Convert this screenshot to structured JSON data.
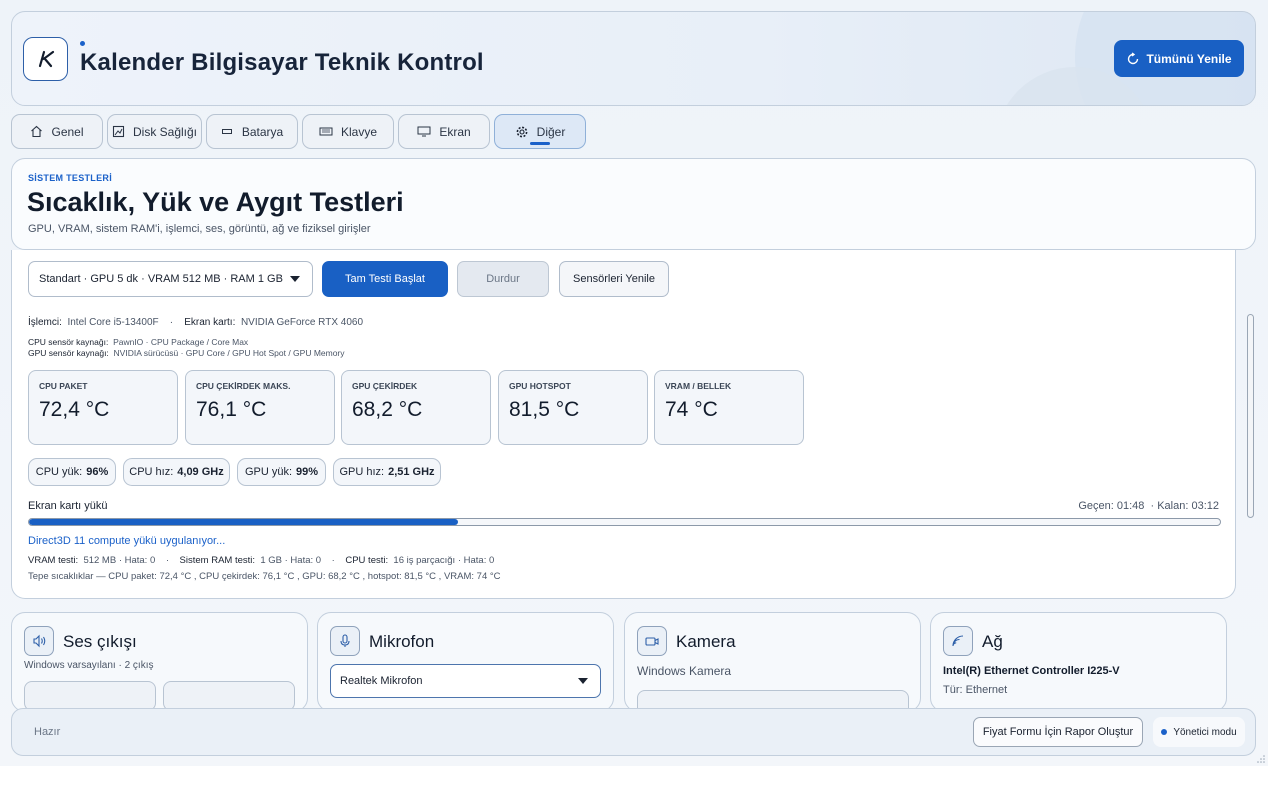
{
  "app": {
    "title": "Kalender Bilgisayar Teknik Kontrol",
    "refresh_all_label": "Tümünü Yenile",
    "accent": "#1960c4"
  },
  "tabs": [
    {
      "label": "Genel",
      "icon": "home-icon"
    },
    {
      "label": "Disk Sağlığı",
      "icon": "disk-icon"
    },
    {
      "label": "Batarya",
      "icon": "battery-icon"
    },
    {
      "label": "Klavye",
      "icon": "keyboard-icon"
    },
    {
      "label": "Ekran",
      "icon": "monitor-icon"
    },
    {
      "label": "Diğer",
      "icon": "gear-icon",
      "active": true
    }
  ],
  "section": {
    "eyebrow": "SİSTEM TESTLERİ",
    "title": "Sıcaklık, Yük ve Aygıt Testleri",
    "subtitle": "GPU, VRAM, sistem RAM'i, işlemci, ses, görüntü, ağ ve fiziksel girişler"
  },
  "controls": {
    "profile_selected": "Standart · GPU 5 dk · VRAM 512 MB · RAM 1 GB",
    "start_label": "Tam Testi Başlat",
    "stop_label": "Durdur",
    "sensors_label": "Sensörleri Yenile"
  },
  "hardware": {
    "cpu_key": "İşlemci:",
    "cpu_value": "Intel Core i5-13400F",
    "separator": "·",
    "gpu_key": "Ekran kartı:",
    "gpu_value": "NVIDIA GeForce RTX 4060",
    "cpu_source_key": "CPU sensör kaynağı:",
    "cpu_source_value": "PawnIO · CPU Package / Core Max",
    "gpu_source_key": "GPU sensör kaynağı:",
    "gpu_source_value": "NVIDIA sürücüsü · GPU Core / GPU Hot Spot / GPU Memory"
  },
  "temps": [
    {
      "label": "CPU PAKET",
      "value": "72,4 °C"
    },
    {
      "label": "CPU ÇEKİRDEK MAKS.",
      "value": "76,1 °C"
    },
    {
      "label": "GPU ÇEKİRDEK",
      "value": "68,2 °C"
    },
    {
      "label": "GPU HOTSPOT",
      "value": "81,5 °C"
    },
    {
      "label": "VRAM / BELLEK",
      "value": "74 °C"
    }
  ],
  "loads": [
    {
      "key": "CPU yük:",
      "value": "96%"
    },
    {
      "key": "CPU hız:",
      "value": "4,09 GHz"
    },
    {
      "key": "GPU yük:",
      "value": "99%"
    },
    {
      "key": "GPU hız:",
      "value": "2,51 GHz"
    }
  ],
  "progress": {
    "label": "Ekran kartı yükü",
    "elapsed": "Geçen: 01:48",
    "remaining": "· Kalan: 03:12",
    "fraction": 0.36,
    "status": "Direct3D 11 compute yükü uygulanıyor..."
  },
  "stats": {
    "vram_key": "VRAM testi:",
    "vram_value": "512 MB · Hata: 0",
    "ram_key": "Sistem RAM testi:",
    "ram_value": "1 GB · Hata: 0",
    "cpu_key": "CPU testi:",
    "cpu_value": "16 iş parçacığı · Hata: 0",
    "sep": "·",
    "peak_line": "Tepe sıcaklıklar — CPU paket: 72,4 °C , CPU çekirdek: 76,1 °C , GPU: 68,2 °C , hotspot: 81,5 °C , VRAM: 74 °C"
  },
  "cards": {
    "sound": {
      "title": "Ses çıkışı",
      "sub": "Windows varsayılanı · 2 çıkış"
    },
    "mic": {
      "title": "Mikrofon",
      "selected": "Realtek Mikrofon"
    },
    "camera": {
      "title": "Kamera",
      "sub": "Windows Kamera"
    },
    "network": {
      "title": "Ağ",
      "adapter": "Intel(R) Ethernet Controller I225-V",
      "type": "Tür: Ethernet"
    }
  },
  "footer": {
    "status": "Hazır",
    "report_label": "Fiyat Formu İçin Rapor Oluştur",
    "admin_label": "Yönetici modu"
  }
}
